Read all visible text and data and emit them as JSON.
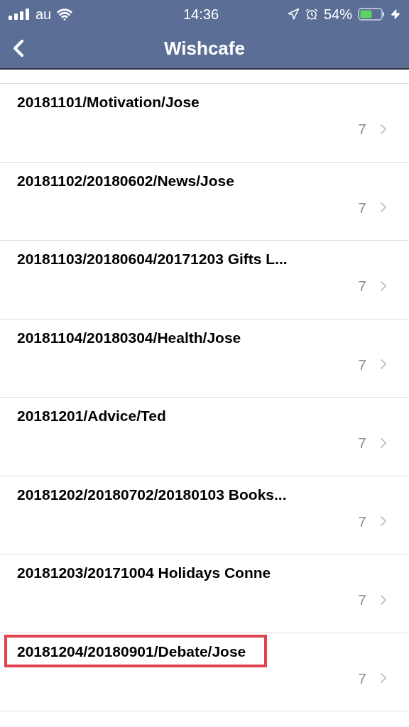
{
  "status_bar": {
    "carrier": "au",
    "time": "14:36",
    "battery": "54%"
  },
  "nav": {
    "title": "Wishcafe"
  },
  "rows": [
    {
      "title": "20181101/Motivation/Jose",
      "count": "7",
      "highlighted": false
    },
    {
      "title": "20181102/20180602/News/Jose",
      "count": "7",
      "highlighted": false
    },
    {
      "title": "20181103/20180604/20171203 Gifts L...",
      "count": "7",
      "highlighted": false
    },
    {
      "title": "20181104/20180304/Health/Jose",
      "count": "7",
      "highlighted": false
    },
    {
      "title": "20181201/Advice/Ted",
      "count": "7",
      "highlighted": false
    },
    {
      "title": "20181202/20180702/20180103 Books...",
      "count": "7",
      "highlighted": false
    },
    {
      "title": "20181203/20171004 Holidays Conne",
      "count": "7",
      "highlighted": false
    },
    {
      "title": "20181204/20180901/Debate/Jose",
      "count": "7",
      "highlighted": true
    }
  ]
}
